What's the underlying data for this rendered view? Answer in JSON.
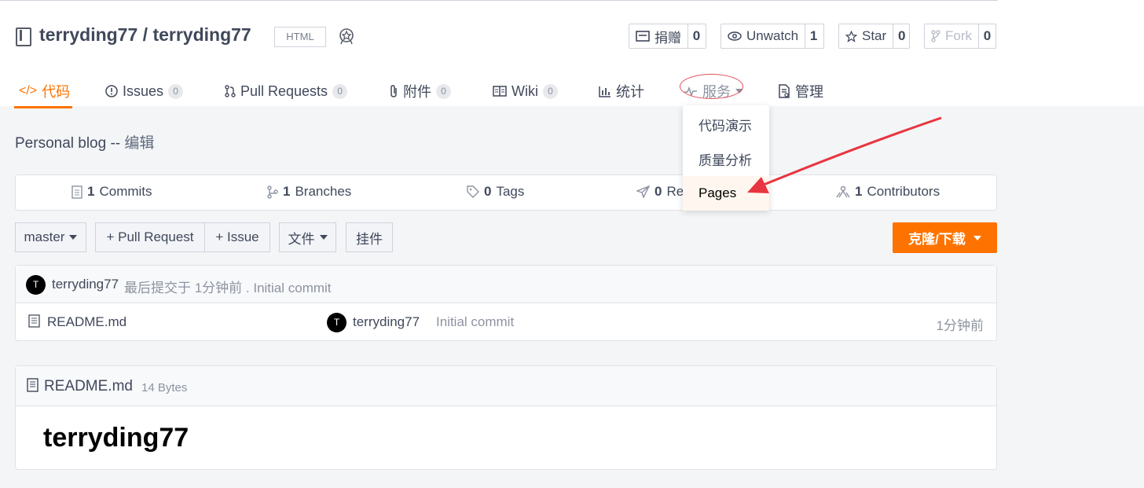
{
  "repo": {
    "owner": "terryding77",
    "separator": "/",
    "name": "terryding77",
    "language": "HTML"
  },
  "actions": {
    "donate": {
      "label": "捐赠",
      "count": "0"
    },
    "watch": {
      "label": "Unwatch",
      "count": "1"
    },
    "star": {
      "label": "Star",
      "count": "0"
    },
    "fork": {
      "label": "Fork",
      "count": "0"
    }
  },
  "tabs": [
    {
      "label": "代码",
      "count": null
    },
    {
      "label": "Issues",
      "count": "0"
    },
    {
      "label": "Pull Requests",
      "count": "0"
    },
    {
      "label": "附件",
      "count": "0"
    },
    {
      "label": "Wiki",
      "count": "0"
    },
    {
      "label": "统计",
      "count": null
    },
    {
      "label": "服务",
      "count": null
    },
    {
      "label": "管理",
      "count": null
    }
  ],
  "services_menu": [
    "代码演示",
    "质量分析",
    "Pages"
  ],
  "description": {
    "text": "Personal blog --",
    "edit": "编辑"
  },
  "stats": [
    {
      "count": "1",
      "label": "Commits"
    },
    {
      "count": "1",
      "label": "Branches"
    },
    {
      "count": "0",
      "label": "Tags"
    },
    {
      "count": "0",
      "label": "Re"
    },
    {
      "count": "1",
      "label": "Contributors"
    }
  ],
  "toolbar": {
    "branch": "master",
    "pull_request": "+ Pull Request",
    "issue": "+ Issue",
    "files": "文件",
    "widgets": "挂件",
    "clone": "克隆/下载"
  },
  "last_commit": {
    "avatar_letter": "T",
    "author": "terryding77",
    "summary": "最后提交于 1分钟前 . Initial commit"
  },
  "files": [
    {
      "name": "README.md",
      "avatar_letter": "T",
      "author": "terryding77",
      "message": "Initial commit",
      "time": "1分钟前"
    }
  ],
  "readme": {
    "filename": "README.md",
    "size": "14 Bytes",
    "heading": "terryding77"
  },
  "colors": {
    "accent": "#fe7300",
    "annotation": "#e8353f"
  }
}
